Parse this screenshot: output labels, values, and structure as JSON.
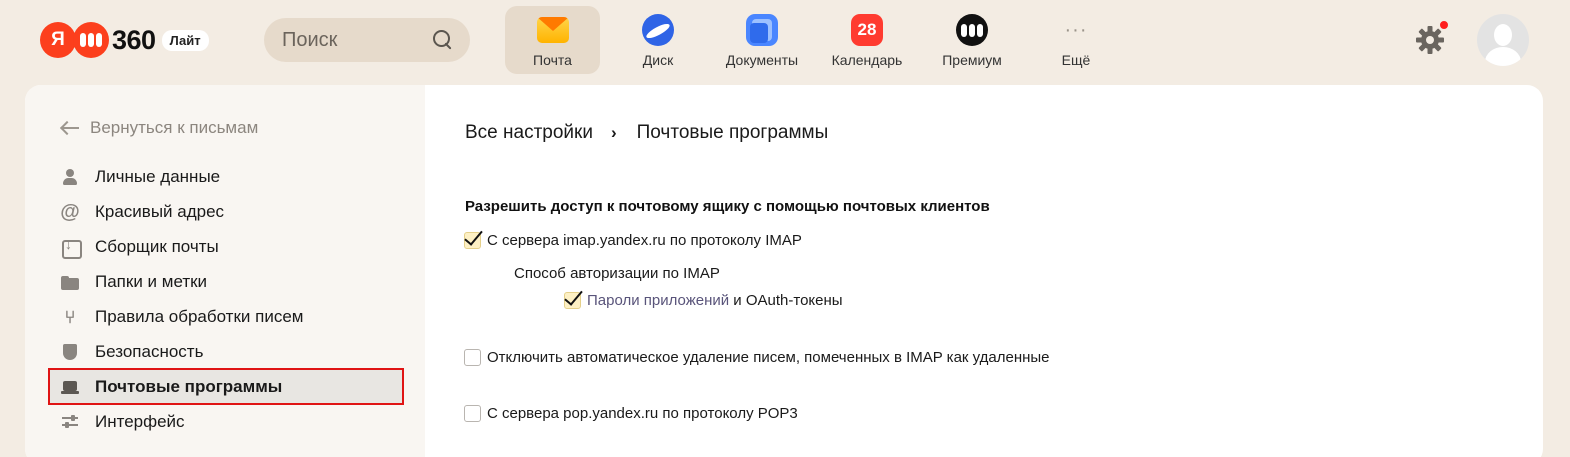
{
  "header": {
    "logo": {
      "ya": "Я",
      "number": "360",
      "badge": "Лайт"
    },
    "search": {
      "placeholder": "Поиск",
      "icon": "search-icon"
    },
    "apps": [
      {
        "label": "Почта",
        "icon": "mail-icon",
        "active": true
      },
      {
        "label": "Диск",
        "icon": "disk-icon"
      },
      {
        "label": "Документы",
        "icon": "documents-icon"
      },
      {
        "label": "Календарь",
        "icon": "calendar-icon",
        "badge": "28"
      },
      {
        "label": "Премиум",
        "icon": "premium-icon"
      },
      {
        "label": "Ещё",
        "icon": "more-icon",
        "glyph": "···"
      }
    ],
    "settings_icon": "gear-icon",
    "notification_color": "#ff1e1e"
  },
  "sidebar": {
    "back_label": "Вернуться к письмам",
    "items": [
      {
        "label": "Личные данные",
        "icon": "user-icon"
      },
      {
        "label": "Красивый адрес",
        "icon": "at-icon",
        "glyph": "@"
      },
      {
        "label": "Сборщик почты",
        "icon": "mail-collector-icon"
      },
      {
        "label": "Папки и метки",
        "icon": "folder-icon"
      },
      {
        "label": "Правила обработки писем",
        "icon": "rules-icon",
        "glyph": "⑂"
      },
      {
        "label": "Безопасность",
        "icon": "shield-icon"
      },
      {
        "label": "Почтовые программы",
        "icon": "laptop-icon",
        "active": true
      },
      {
        "label": "Интерфейс",
        "icon": "sliders-icon"
      }
    ]
  },
  "main": {
    "breadcrumb": {
      "root": "Все настройки",
      "separator": "›",
      "current": "Почтовые программы"
    },
    "section_title": "Разрешить доступ к почтовому ящику с помощью почтовых клиентов",
    "imap": {
      "label": "С сервера imap.yandex.ru по протоколу IMAP",
      "checked": true
    },
    "imap_auth": {
      "title": "Способ авторизации по IMAP",
      "app_passwords_link": "Пароли приложений",
      "rest": " и OAuth-токены",
      "checked": true
    },
    "disable_autodelete": {
      "label": "Отключить автоматическое удаление писем, помеченных в IMAP как удаленные",
      "checked": false
    },
    "pop3": {
      "label": "С сервера pop.yandex.ru по протоколу POP3",
      "checked": false
    }
  },
  "colors": {
    "background": "#f3ece3",
    "accent_red": "#fc3f1d",
    "checkbox_checked": "#fdf0c4",
    "link": "#59547a",
    "highlight_box": "#e01414"
  }
}
